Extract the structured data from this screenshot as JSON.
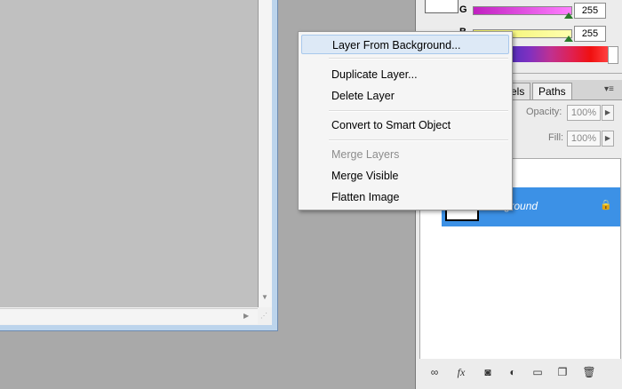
{
  "color_panel": {
    "channels": [
      {
        "label": "G",
        "value": "255",
        "slider_color": "#e020e0"
      },
      {
        "label": "B",
        "value": "255",
        "slider_color": "#e8e820"
      }
    ]
  },
  "layers_panel": {
    "tabs": [
      {
        "label": "els"
      },
      {
        "label": "Paths"
      }
    ],
    "opacity_label": "Opacity:",
    "opacity_value": "100%",
    "fill_label": "Fill:",
    "fill_value": "100%",
    "layer": {
      "name": "Background",
      "selected_color": "#3c91e6"
    }
  },
  "context_menu": {
    "items": [
      {
        "label": "Layer From Background...",
        "highlighted": true,
        "enabled": true
      },
      {
        "label": "Duplicate Layer...",
        "enabled": true
      },
      {
        "label": "Delete Layer",
        "enabled": true
      },
      {
        "label": "Convert to Smart Object",
        "enabled": true
      },
      {
        "label": "Merge Layers",
        "enabled": false
      },
      {
        "label": "Merge Visible",
        "enabled": true
      },
      {
        "label": "Flatten Image",
        "enabled": true
      }
    ]
  },
  "footer_icons": [
    "link-icon",
    "fx-icon",
    "mask-icon",
    "adjustment-icon",
    "folder-icon",
    "new-layer-icon",
    "trash-icon"
  ]
}
